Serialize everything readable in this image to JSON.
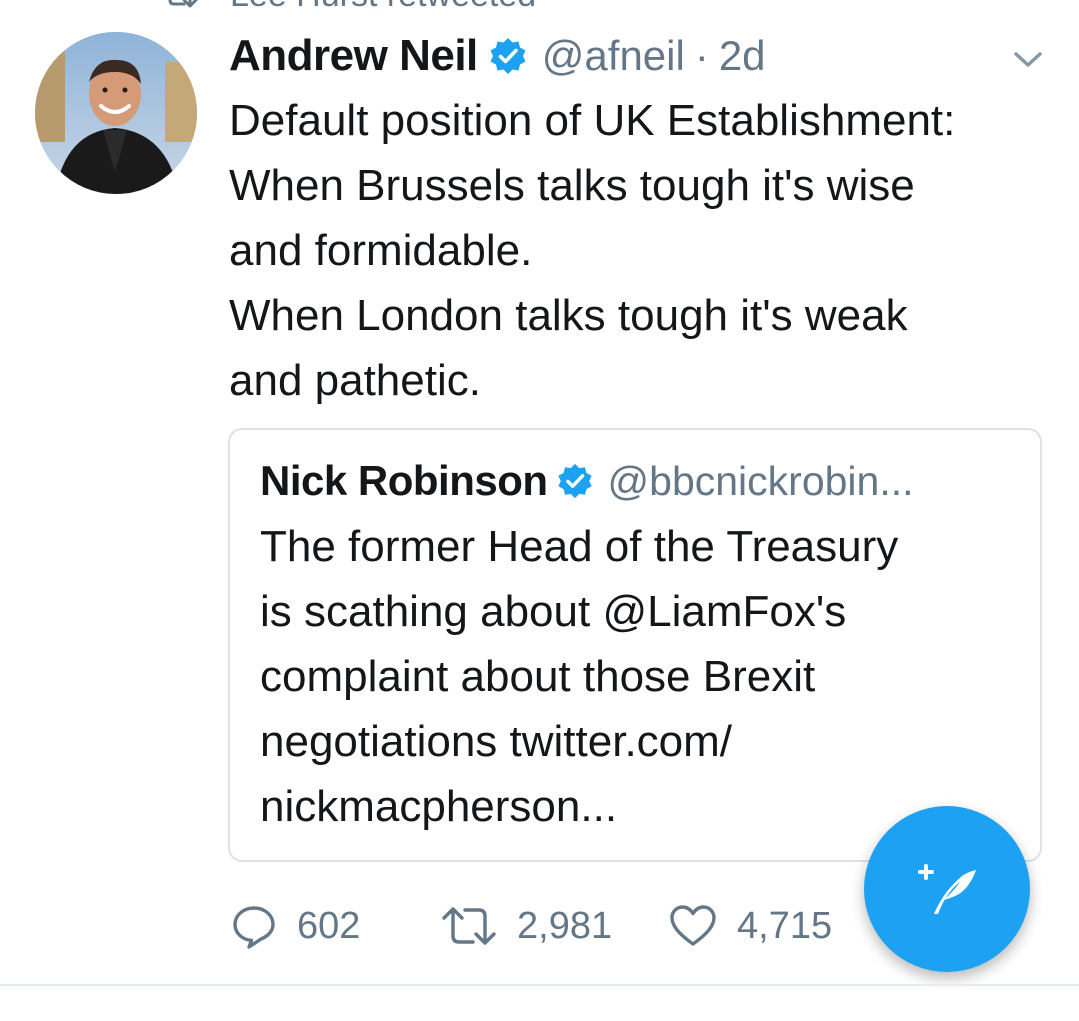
{
  "retweet_context": {
    "text": "Lee Hurst retweeted",
    "icon": "retweet-icon"
  },
  "tweet": {
    "author": {
      "name": "Andrew Neil",
      "handle": "@afneil",
      "verified": true,
      "avatar": "avatar-photo"
    },
    "separator": "·",
    "time": "2d",
    "menu_icon": "chevron-down-icon",
    "text_lines": [
      "Default position of UK Establishment:",
      "When Brussels talks tough it's wise",
      "and formidable.",
      "When London talks tough it's weak",
      "and pathetic."
    ],
    "quoted": {
      "name": "Nick Robinson",
      "handle": "@bbcnickrobin...",
      "verified": true,
      "text_lines": [
        "The former Head of the Treasury",
        "is scathing about @LiamFox's",
        "complaint about those Brexit",
        "negotiations twitter.com/",
        "nickmacpherson..."
      ]
    },
    "actions": {
      "replies": "602",
      "retweets": "2,981",
      "likes": "4,715"
    }
  },
  "compose_button": {
    "icon": "compose-feather-icon"
  },
  "colors": {
    "brand_blue": "#1da1f2",
    "muted_text": "#657786",
    "primary_text": "#14171a",
    "border": "#dbe2e8"
  }
}
